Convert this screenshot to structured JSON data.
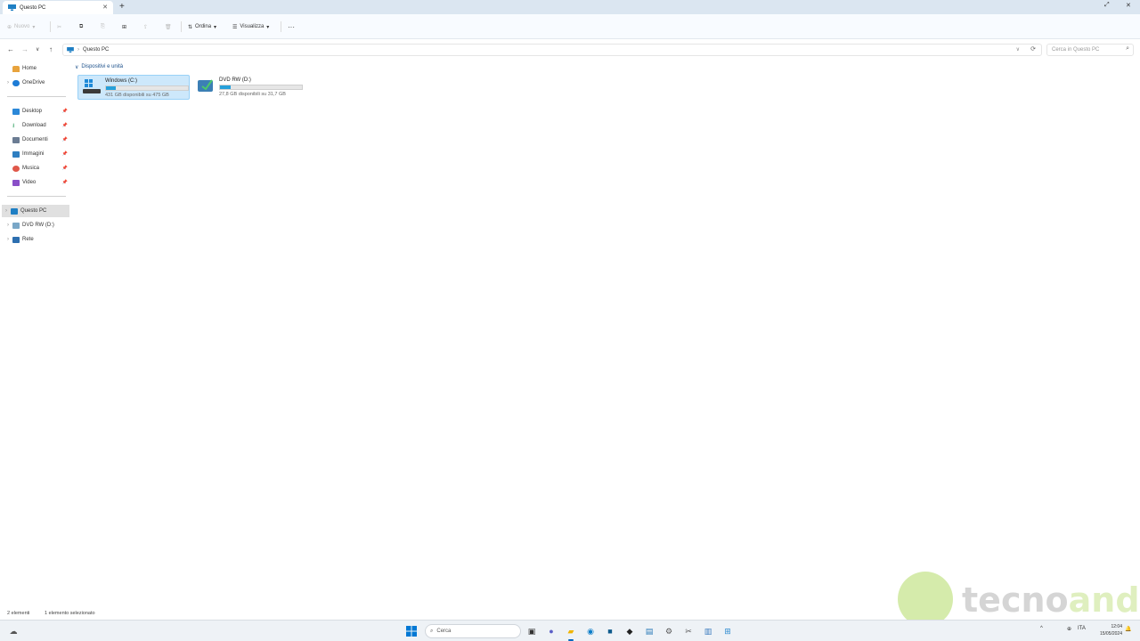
{
  "window": {
    "tab_title": "Questo PC",
    "new_tab_symbol": "+"
  },
  "commandbar": {
    "new_label": "Nuovo",
    "sort_label": "Ordina",
    "view_label": "Visualizza",
    "more_label": "···"
  },
  "address": {
    "path": "Questo PC",
    "search_placeholder": "Cerca in Questo PC"
  },
  "sidebar": {
    "top": [
      {
        "label": "Home",
        "icon": "home-icon"
      },
      {
        "label": "OneDrive",
        "icon": "cloud-icon"
      }
    ],
    "pinned": [
      {
        "label": "Desktop",
        "icon": "desktop-icon"
      },
      {
        "label": "Download",
        "icon": "download-icon"
      },
      {
        "label": "Documenti",
        "icon": "documents-icon"
      },
      {
        "label": "Immagini",
        "icon": "pictures-icon"
      },
      {
        "label": "Musica",
        "icon": "music-icon"
      },
      {
        "label": "Video",
        "icon": "video-icon"
      }
    ],
    "bottom": [
      {
        "label": "Questo PC",
        "icon": "pc-icon",
        "selected": true
      },
      {
        "label": "DVD RW (D:)",
        "icon": "dvd-icon"
      },
      {
        "label": "Rete",
        "icon": "network-icon"
      }
    ]
  },
  "content": {
    "group_header": "Dispositivi e unità",
    "drives": [
      {
        "name": "Windows (C:)",
        "info": "431 GB disponibili su 475 GB",
        "used_fraction": 0.12,
        "selected": true
      },
      {
        "name": "DVD RW (D:)",
        "info": "27,8 GB disponibili su 31,7 GB",
        "used_fraction": 0.13,
        "selected": false
      }
    ]
  },
  "status": {
    "items_count": "2 elementi",
    "selection": "1 elemento selezionato"
  },
  "taskbar": {
    "search_label": "Cerca",
    "lang": "ITA",
    "time": "12:04",
    "date": "15/05/2024"
  },
  "watermark": {
    "part1": "tecno",
    "part2": "android"
  },
  "colors": {
    "accent": "#0067c0",
    "selection_bg": "#cde8fb",
    "bar_fill": "#26a0da"
  }
}
